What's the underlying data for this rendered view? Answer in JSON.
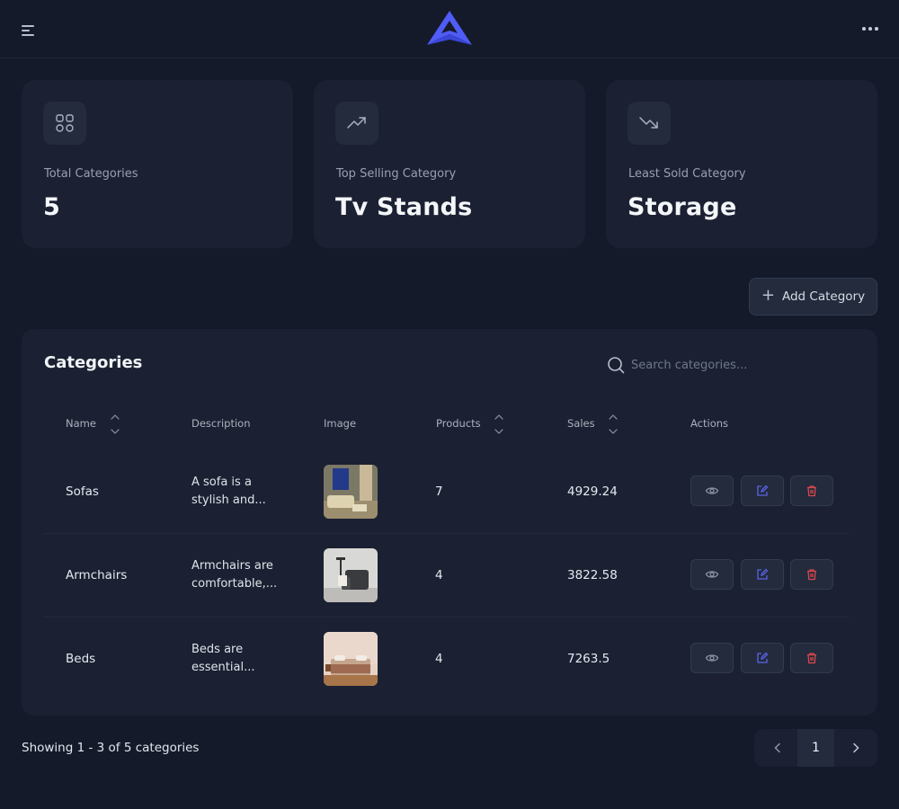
{
  "header": {
    "menu_icon": "hamburger-menu-icon",
    "logo_icon": "triangle-logo",
    "more_icon": "more-horizontal-icon",
    "brand_color": "#4f5cf6"
  },
  "stats": [
    {
      "icon": "grid-icon",
      "label": "Total Categories",
      "value": "5"
    },
    {
      "icon": "trending-up-icon",
      "label": "Top Selling Category",
      "value": "Tv Stands"
    },
    {
      "icon": "trending-down-icon",
      "label": "Least Sold Category",
      "value": "Storage"
    }
  ],
  "add_button": {
    "label": "Add Category",
    "icon": "plus-icon"
  },
  "table": {
    "title": "Categories",
    "search_placeholder": "Search categories...",
    "columns": [
      "Name",
      "Description",
      "Image",
      "Products",
      "Sales",
      "Actions"
    ],
    "sortable": [
      "Name",
      "Products",
      "Sales"
    ],
    "rows": [
      {
        "name": "Sofas",
        "description": [
          "A sofa is a",
          "stylish and..."
        ],
        "image": "sofa-photo",
        "products": "7",
        "sales": "4929.24"
      },
      {
        "name": "Armchairs",
        "description": [
          "Armchairs are",
          "comfortable,..."
        ],
        "image": "armchair-photo",
        "products": "4",
        "sales": "3822.58"
      },
      {
        "name": "Beds",
        "description": [
          "Beds are",
          "essential..."
        ],
        "image": "bed-photo",
        "products": "4",
        "sales": "7263.5"
      }
    ],
    "actions": [
      {
        "icon": "eye-icon",
        "color": "#8d96a6"
      },
      {
        "icon": "edit-icon",
        "color": "#5b63e6"
      },
      {
        "icon": "trash-icon",
        "color": "#d9474d"
      }
    ]
  },
  "footer": {
    "showing": "Showing 1 - 3 of 5 categories",
    "current_page": "1",
    "prev_icon": "chevron-left-icon",
    "next_icon": "chevron-right-icon"
  }
}
